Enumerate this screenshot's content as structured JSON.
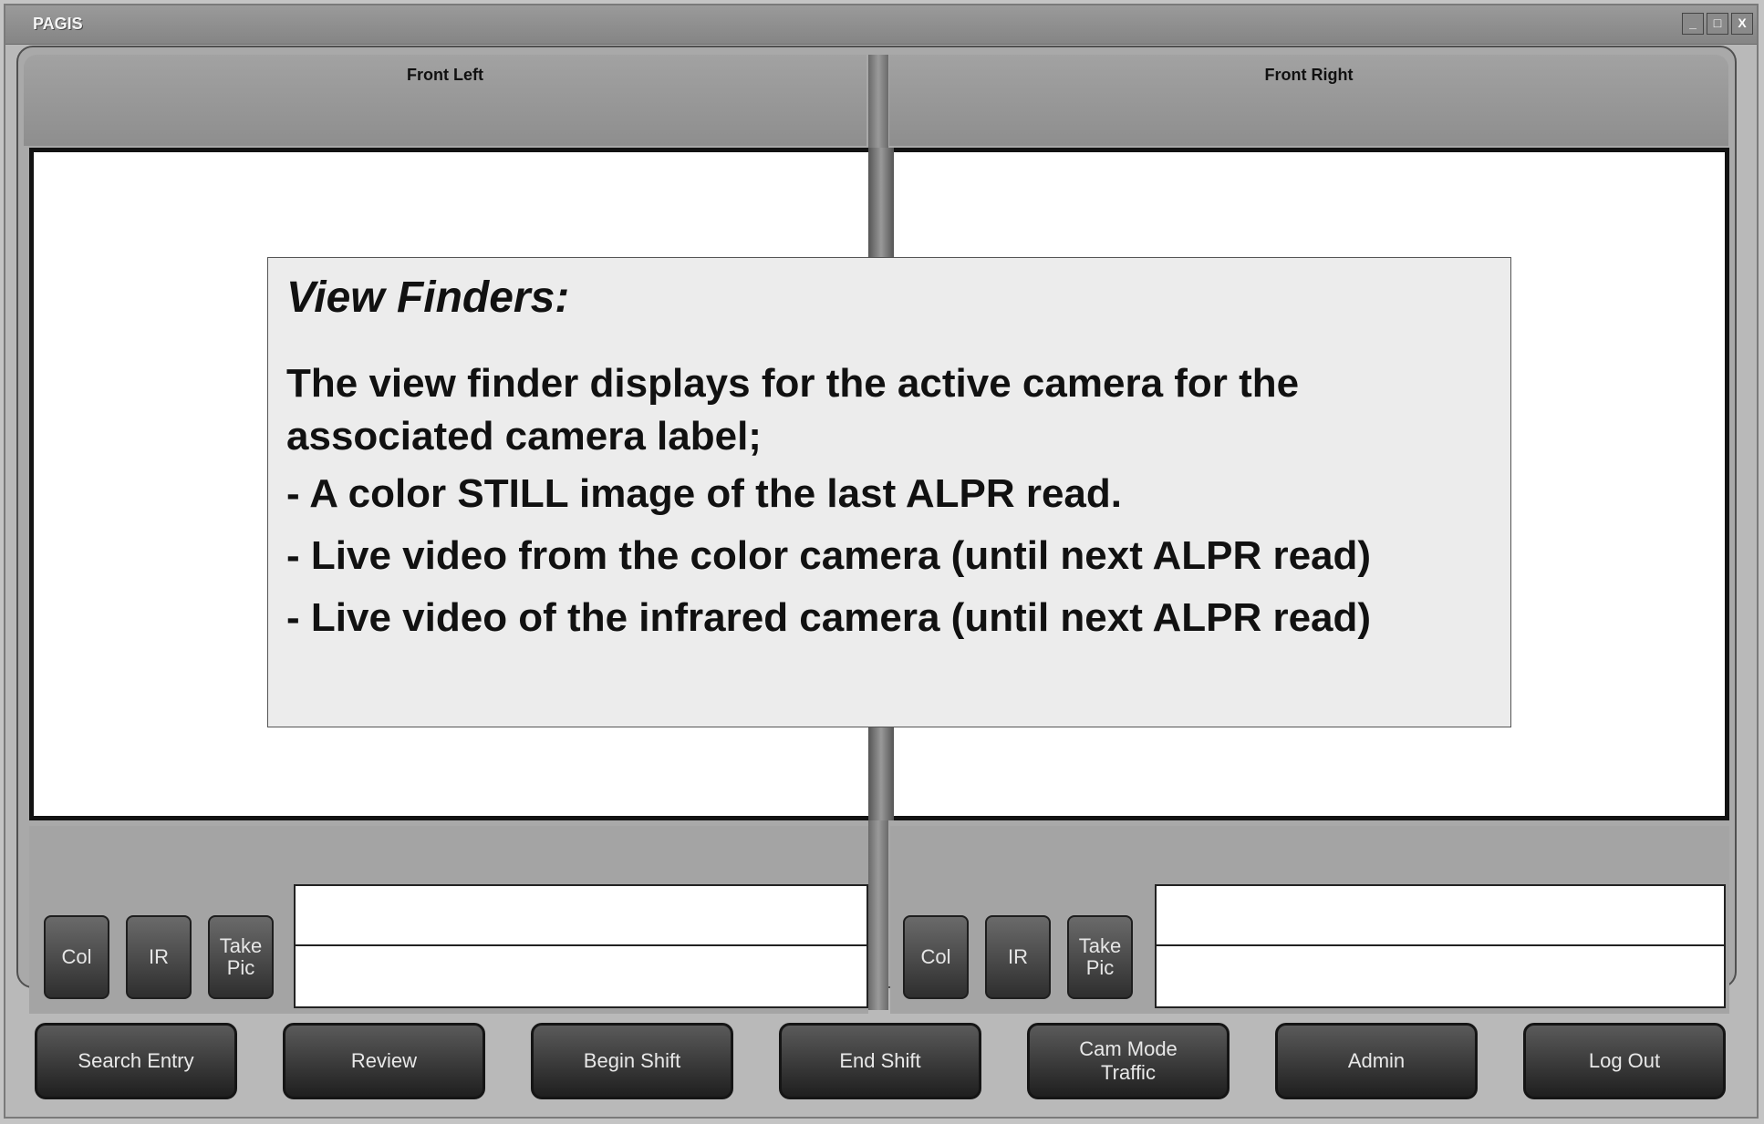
{
  "app": {
    "title": "PAGIS"
  },
  "window_controls": {
    "minimize": "_",
    "maximize": "□",
    "close": "X"
  },
  "panes": {
    "left": {
      "label": "Front Left"
    },
    "right": {
      "label": "Front Right"
    }
  },
  "callout": {
    "heading": "View Finders:",
    "paragraph": "The view finder displays for the active camera for the associated camera label;",
    "bullets": [
      "- A color STILL image of the last ALPR read.",
      "- Live video from the color camera (until next ALPR read)",
      "- Live video of the infrared camera (until next ALPR read)"
    ]
  },
  "camera_controls": {
    "col": "Col",
    "ir": "IR",
    "take_pic_line1": "Take",
    "take_pic_line2": "Pic"
  },
  "bottom_buttons": {
    "search_entry": "Search Entry",
    "review": "Review",
    "begin_shift": "Begin Shift",
    "end_shift": "End Shift",
    "cam_mode_line1": "Cam Mode",
    "cam_mode_line2": "Traffic",
    "admin": "Admin",
    "log_out": "Log Out"
  }
}
